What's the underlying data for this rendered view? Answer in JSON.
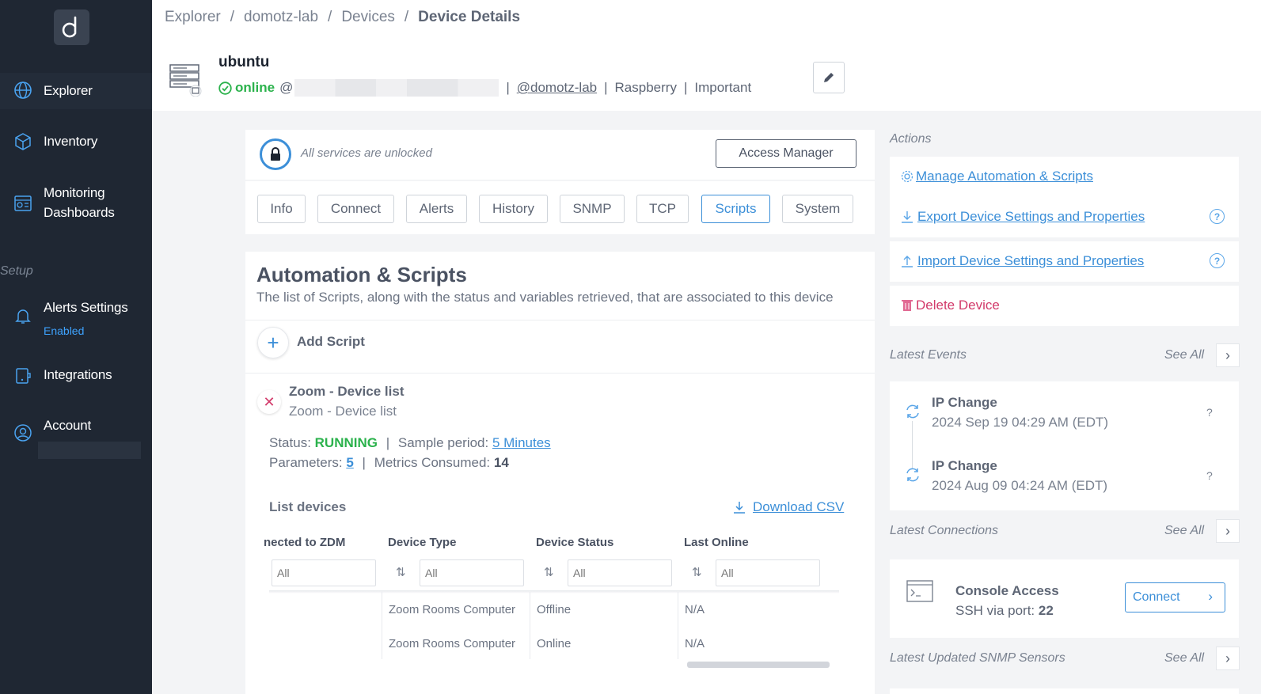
{
  "sidebar": {
    "items": [
      {
        "label": "Explorer",
        "icon": "globe-icon"
      },
      {
        "label": "Inventory",
        "icon": "cube-icon"
      },
      {
        "label": "Monitoring",
        "label2": "Dashboards",
        "icon": "dashboard-icon"
      },
      {
        "label": "Alerts Settings",
        "sub": "Enabled",
        "icon": "bell-icon"
      },
      {
        "label": "Integrations",
        "icon": "integrations-icon"
      },
      {
        "label": "Account",
        "icon": "user-icon"
      }
    ],
    "setup_label": "Setup"
  },
  "breadcrumb": [
    "Explorer",
    "domotz-lab",
    "Devices",
    "Device Details"
  ],
  "device": {
    "name": "ubuntu",
    "status": "online",
    "at": "@",
    "agent": "@domotz-lab",
    "type": "Raspberry",
    "importance": "Important"
  },
  "lock": {
    "text": "All services are unlocked",
    "access_button": "Access Manager"
  },
  "tabs": [
    "Info",
    "Connect",
    "Alerts",
    "History",
    "SNMP",
    "TCP",
    "Scripts",
    "System"
  ],
  "active_tab": "Scripts",
  "automation": {
    "title": "Automation & Scripts",
    "description": "The list of Scripts, along with the status and variables retrieved, that are associated to this device",
    "add_label": "Add Script",
    "script": {
      "name": "Zoom - Device list",
      "subtitle": "Zoom - Device list",
      "status_label": "Status:",
      "status": "RUNNING",
      "sample_label": "Sample period:",
      "sample_value": "5 Minutes",
      "params_label": "Parameters:",
      "params_value": "5",
      "metrics_label": "Metrics Consumed:",
      "metrics_value": "14"
    },
    "list_title": "List devices",
    "download_csv": "Download CSV",
    "table": {
      "columns": [
        "nected to ZDM",
        "Device Type",
        "Device Status",
        "Last Online"
      ],
      "filter_placeholder": "All",
      "rows": [
        [
          "",
          "Zoom Rooms Computer",
          "Offline",
          "N/A"
        ],
        [
          "",
          "Zoom Rooms Computer",
          "Online",
          "N/A"
        ]
      ]
    }
  },
  "actions": {
    "label": "Actions",
    "items": [
      {
        "label": "Manage Automation & Scripts",
        "icon": "gear-icon"
      },
      {
        "label": "Export Device Settings and Properties",
        "icon": "download-icon"
      },
      {
        "label": "Import Device Settings and Properties",
        "icon": "upload-icon"
      },
      {
        "label": "Delete Device",
        "icon": "trash-icon"
      }
    ]
  },
  "events": {
    "label": "Latest Events",
    "see_all": "See All",
    "items": [
      {
        "title": "IP Change",
        "time": "2024 Sep 19 04:29 AM (EDT)",
        "q": "?"
      },
      {
        "title": "IP Change",
        "time": "2024 Aug 09 04:24 AM (EDT)",
        "q": "?"
      }
    ]
  },
  "connections": {
    "label": "Latest Connections",
    "see_all": "See All",
    "title": "Console Access",
    "sub_label": "SSH via port:",
    "port": "22",
    "connect_button": "Connect"
  },
  "snmp": {
    "label": "Latest Updated SNMP Sensors",
    "see_all": "See All"
  },
  "colors": {
    "sidebar_bg": "#1f2733",
    "accent": "#3c8fd8",
    "online": "#2bb24c",
    "danger": "#d23a6a"
  }
}
